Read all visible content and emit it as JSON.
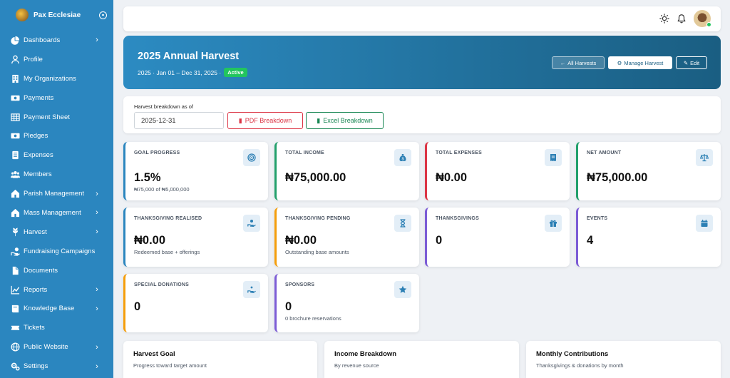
{
  "sidebar": {
    "brand": "Pax Ecclesiae",
    "items": [
      {
        "label": "Dashboards",
        "icon": "pie-chart-icon",
        "chevron": true
      },
      {
        "label": "Profile",
        "icon": "user-icon",
        "chevron": false
      },
      {
        "label": "My Organizations",
        "icon": "building-icon",
        "chevron": false
      },
      {
        "label": "Payments",
        "icon": "money-icon",
        "chevron": false
      },
      {
        "label": "Payment Sheet",
        "icon": "table-icon",
        "chevron": false
      },
      {
        "label": "Pledges",
        "icon": "money-icon",
        "chevron": false
      },
      {
        "label": "Expenses",
        "icon": "document-icon",
        "chevron": false
      },
      {
        "label": "Members",
        "icon": "users-icon",
        "chevron": false
      },
      {
        "label": "Parish Management",
        "icon": "church-icon",
        "chevron": true
      },
      {
        "label": "Mass Management",
        "icon": "church-icon",
        "chevron": true
      },
      {
        "label": "Harvest",
        "icon": "harvest-icon",
        "chevron": true
      },
      {
        "label": "Fundraising Campaigns",
        "icon": "hand-coin-icon",
        "chevron": false
      },
      {
        "label": "Documents",
        "icon": "file-icon",
        "chevron": false
      },
      {
        "label": "Reports",
        "icon": "line-chart-icon",
        "chevron": true
      },
      {
        "label": "Knowledge Base",
        "icon": "book-icon",
        "chevron": true
      },
      {
        "label": "Tickets",
        "icon": "ticket-icon",
        "chevron": false
      },
      {
        "label": "Public Website",
        "icon": "globe-icon",
        "chevron": true
      },
      {
        "label": "Settings",
        "icon": "gears-icon",
        "chevron": true
      }
    ]
  },
  "hero": {
    "title": "2025 Annual Harvest",
    "subtitle": "2025 · Jan 01 – Dec 31, 2025 ·",
    "status": "Active",
    "buttons": {
      "all": "All Harvests",
      "manage": "Manage Harvest",
      "edit": "Edit"
    }
  },
  "breakdown": {
    "label": "Harvest breakdown as of",
    "date": "2025-12-31",
    "pdf": "PDF Breakdown",
    "excel": "Excel Breakdown"
  },
  "cards": [
    {
      "label": "GOAL PROGRESS",
      "value": "1.5%",
      "sub": "₦75,000 of ₦5,000,000",
      "icon": "target-icon",
      "accent": "#2b86bf"
    },
    {
      "label": "TOTAL INCOME",
      "value": "₦75,000.00",
      "sub": "",
      "icon": "money-bag-icon",
      "accent": "#22a06b"
    },
    {
      "label": "TOTAL EXPENSES",
      "value": "₦0.00",
      "sub": "",
      "icon": "receipt-icon",
      "accent": "#dc3545"
    },
    {
      "label": "NET AMOUNT",
      "value": "₦75,000.00",
      "sub": "",
      "icon": "scale-icon",
      "accent": "#22a06b"
    },
    {
      "label": "THANKSGIVING REALISED",
      "value": "₦0.00",
      "sub": "Redeemed base + offerings",
      "icon": "hand-user-icon",
      "accent": "#2b86bf"
    },
    {
      "label": "THANKSGIVING PENDING",
      "value": "₦0.00",
      "sub": "Outstanding base amounts",
      "icon": "hourglass-icon",
      "accent": "#f59e0b"
    },
    {
      "label": "THANKSGIVINGS",
      "value": "0",
      "sub": "",
      "icon": "gift-icon",
      "accent": "#7c5cd6"
    },
    {
      "label": "EVENTS",
      "value": "4",
      "sub": "",
      "icon": "calendar-icon",
      "accent": "#7c5cd6"
    },
    {
      "label": "SPECIAL DONATIONS",
      "value": "0",
      "sub": "",
      "icon": "donate-icon",
      "accent": "#f59e0b"
    },
    {
      "label": "SPONSORS",
      "value": "0",
      "sub": "0 brochure reservations",
      "icon": "star-icon",
      "accent": "#7c5cd6"
    }
  ],
  "bottom": [
    {
      "title": "Harvest Goal",
      "sub": "Progress toward target amount"
    },
    {
      "title": "Income Breakdown",
      "sub": "By revenue source"
    },
    {
      "title": "Monthly Contributions",
      "sub": "Thanksgivings & donations by month"
    }
  ],
  "colors": {
    "sidebar": "#2b86bf",
    "hero_start": "#2c8bc2",
    "hero_end": "#1a5e82",
    "success": "#22c55e",
    "danger": "#dc3545"
  }
}
